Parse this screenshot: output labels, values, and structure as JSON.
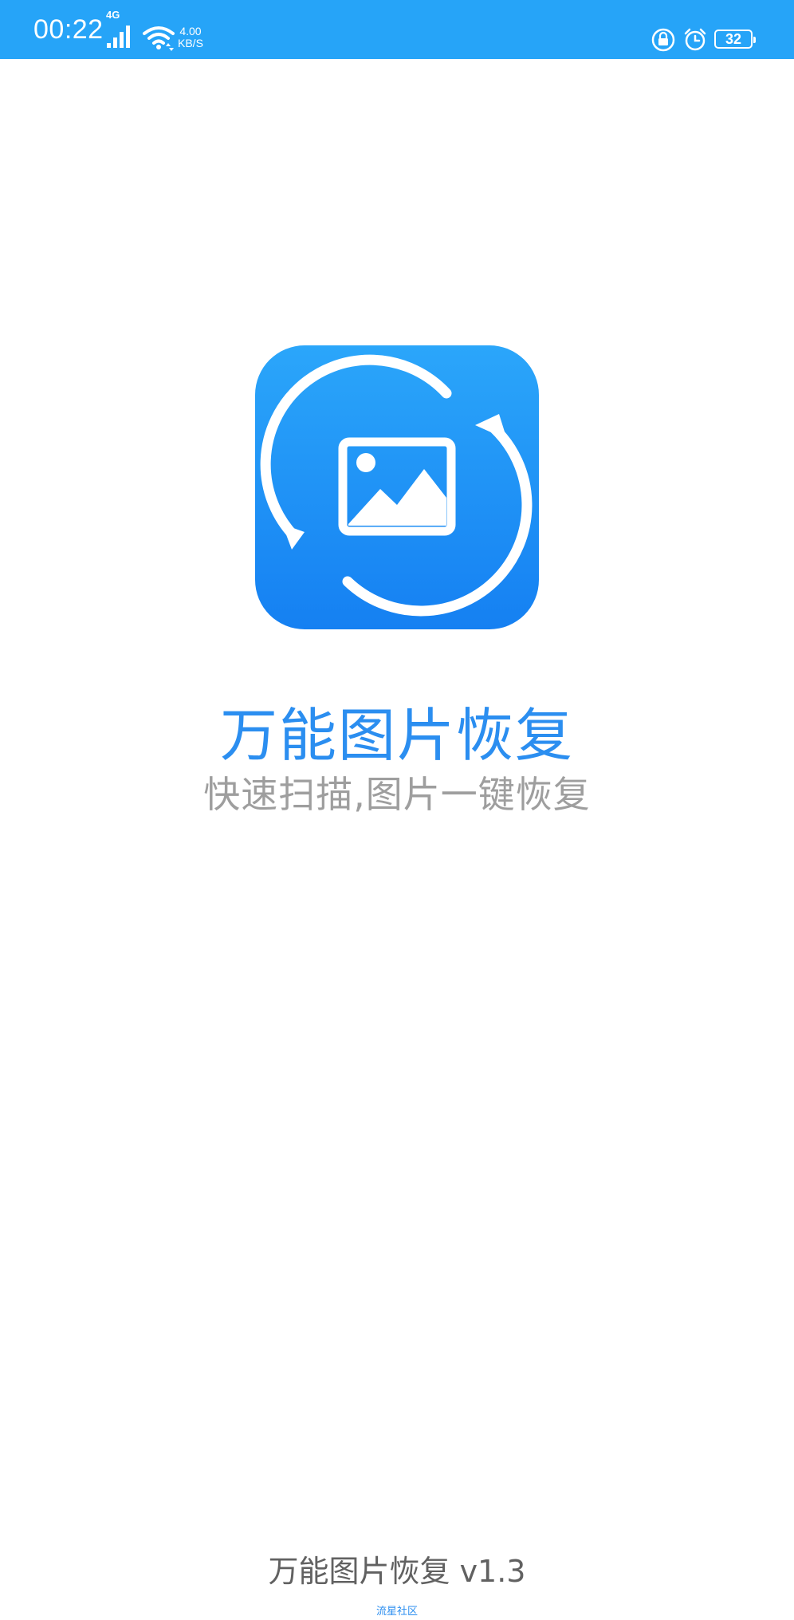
{
  "status_bar": {
    "time": "00:22",
    "network_type": "4G",
    "net_speed_value": "4.00",
    "net_speed_unit": "KB/S",
    "battery_level": "32",
    "background_color": "#26a4f8",
    "icons": [
      "signal-icon",
      "wifi-icon",
      "rotation-lock-icon",
      "alarm-icon",
      "battery-icon"
    ]
  },
  "splash": {
    "logo_icon": "image-recovery-icon",
    "title": "万能图片恢复",
    "tagline": "快速扫描,图片一键恢复",
    "title_color": "#2b8ef0",
    "tagline_color": "#9e9e9e",
    "logo_colors": [
      "#2ba6fa",
      "#1580f2"
    ]
  },
  "footer": {
    "version_label": "万能图片恢复 v1.3",
    "watermark": "流星社区"
  }
}
